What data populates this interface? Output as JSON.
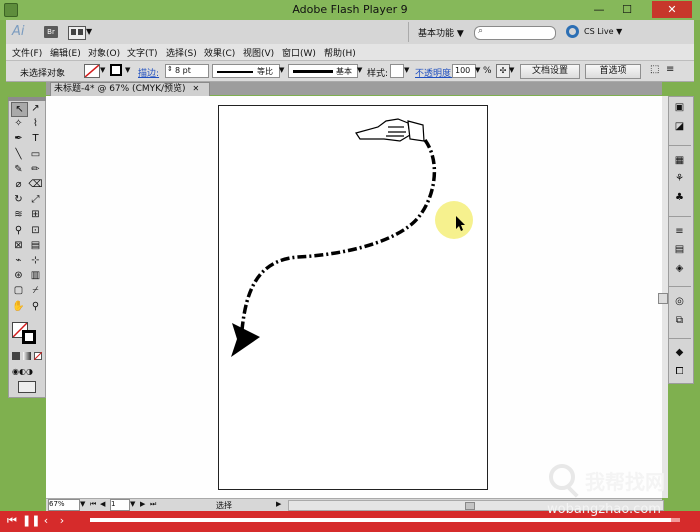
{
  "window": {
    "title": "Adobe Flash Player 9",
    "close_glyph": "✕",
    "min_glyph": "—",
    "max_glyph": "☐"
  },
  "appbar": {
    "logo": "Ai",
    "bridge": "Br",
    "workspace": "基本功能",
    "search_placeholder": "",
    "cslive": "CS Live"
  },
  "menus": [
    "文件(F)",
    "编辑(E)",
    "对象(O)",
    "文字(T)",
    "选择(S)",
    "效果(C)",
    "视图(V)",
    "窗口(W)",
    "帮助(H)"
  ],
  "control": {
    "selection": "未选择对象",
    "stroke_label": "描边:",
    "stroke_value": "8 pt",
    "profile": "等比",
    "brush": "基本",
    "style_label": "样式:",
    "opacity_label": "不透明度:",
    "opacity_value": "100",
    "percent": "%",
    "doc_settings": "文档设置",
    "preferences": "首选项"
  },
  "tab": {
    "label": "未标题-4* @ 67% (CMYK/预览)",
    "close": "✕"
  },
  "status": {
    "zoom": "67%",
    "page": "1",
    "tool": "选择"
  },
  "player": {
    "progress": 0.985
  },
  "watermark": {
    "cn": "我帮找网",
    "url": "wobangzhao.com"
  },
  "colors": {
    "accent": "#d62b2b",
    "titlebar": "#86b85a",
    "highlight": "#f4ee7a"
  },
  "icons": [
    "pointing-hand-icon",
    "arrow-cursor-icon",
    "arrowhead-icon"
  ]
}
